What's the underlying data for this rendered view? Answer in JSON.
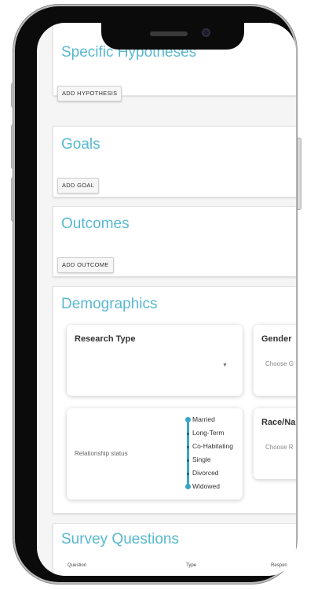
{
  "sections": {
    "hypotheses": {
      "title": "Specific Hypotheses",
      "button": "ADD HYPOTHESIS"
    },
    "goals": {
      "title": "Goals",
      "button": "ADD GOAL"
    },
    "outcomes": {
      "title": "Outcomes",
      "button": "ADD OUTCOME"
    },
    "demographics": {
      "title": "Demographics",
      "research_type": {
        "label": "Research Type",
        "value": ""
      },
      "gender": {
        "label": "Gender",
        "placeholder": "Choose G"
      },
      "race": {
        "label": "Race/Na",
        "placeholder": "Choose R"
      },
      "relationship": {
        "label": "Relationship status",
        "options": [
          "Married",
          "Long-Term",
          "Co-Habitating",
          "Single",
          "Divorced",
          "Widowed"
        ]
      }
    },
    "survey": {
      "title": "Survey Questions",
      "columns": [
        "Question",
        "Type",
        "Respon"
      ]
    }
  },
  "colors": {
    "accent": "#59b9cf",
    "slider": "#3aa5c6"
  },
  "icons": {
    "select_arrow": "caret-down-icon"
  }
}
